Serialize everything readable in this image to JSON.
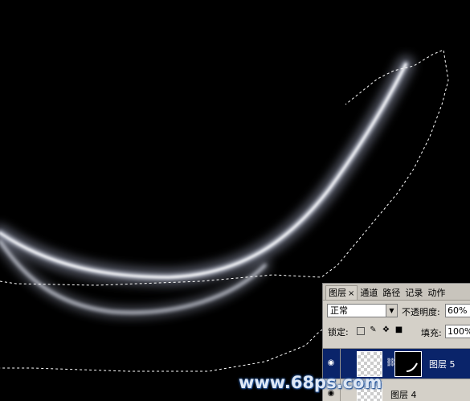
{
  "layers_panel": {
    "tabs": [
      {
        "label": "图层",
        "close": "×"
      },
      {
        "label": "通道"
      },
      {
        "label": "路径"
      },
      {
        "label": "记录"
      },
      {
        "label": "动作"
      }
    ],
    "blend_mode": "正常",
    "opacity_label": "不透明度:",
    "opacity_value": "60%",
    "lock_label": "锁定:",
    "fill_label": "填充:",
    "fill_value": "100%",
    "layers": [
      {
        "name": "图层 5",
        "selected": true,
        "has_mask": true
      },
      {
        "name": "图层 4",
        "selected": false,
        "has_mask": false
      }
    ]
  },
  "watermark": "www.68ps.com",
  "colors": {
    "canvas_background": "#000000",
    "panel_background": "#d4d0c8",
    "selected_layer": "#0a246a",
    "watermark_glow": "#2a5ea8"
  }
}
